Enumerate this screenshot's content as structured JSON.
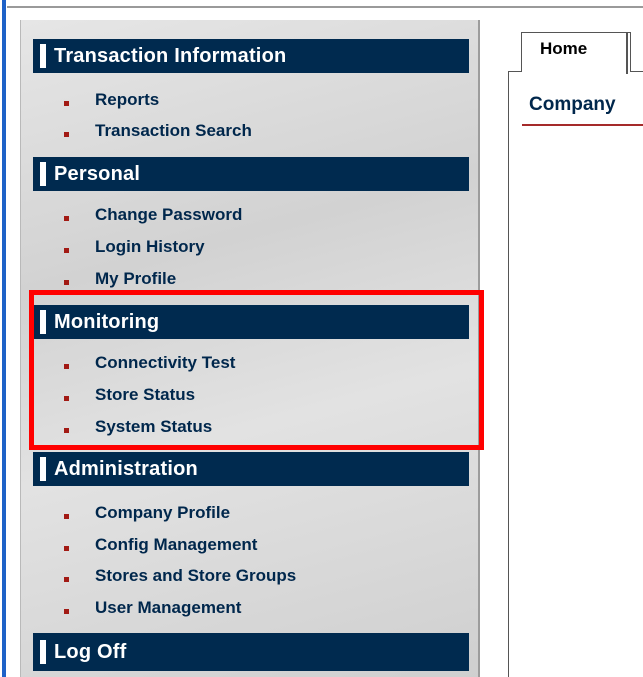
{
  "sidebar": {
    "sections": [
      {
        "title": "Transaction Information",
        "items": [
          "Reports",
          "Transaction Search"
        ]
      },
      {
        "title": "Personal",
        "items": [
          "Change Password",
          "Login History",
          "My Profile"
        ]
      },
      {
        "title": "Monitoring",
        "items": [
          "Connectivity Test",
          "Store Status",
          "System Status"
        ]
      },
      {
        "title": "Administration",
        "items": [
          "Company Profile",
          "Config Management",
          "Stores and Store Groups",
          "User Management"
        ]
      },
      {
        "title": "Log Off",
        "items": []
      }
    ]
  },
  "main": {
    "tab_label": "Home",
    "heading": "Company"
  },
  "colors": {
    "header_bg": "#002a4f",
    "bullet": "#a21a14",
    "highlight": "#ff0000",
    "link_text": "#00274c"
  }
}
